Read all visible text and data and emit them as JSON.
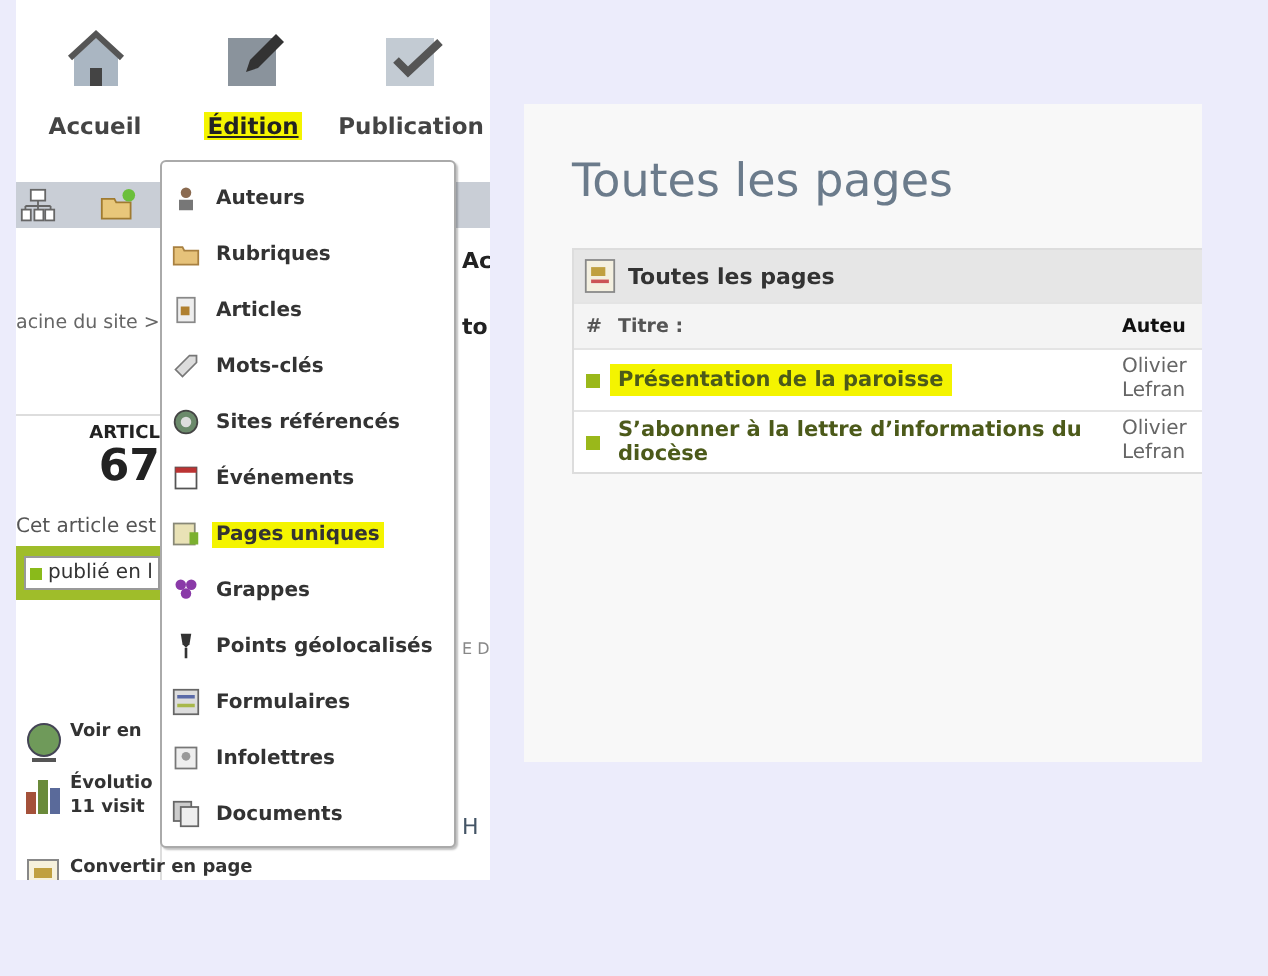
{
  "nav": [
    {
      "label": "Accueil",
      "selected": false,
      "highlighted": false
    },
    {
      "label": "Édition",
      "selected": true,
      "highlighted": true
    },
    {
      "label": "Publication",
      "selected": false,
      "highlighted": false
    }
  ],
  "background_page": {
    "heading_fragment": "Ac",
    "breadcrumb": "acine du site >",
    "title_fragment": "to",
    "stat_label": "ARTICL",
    "stat_value": "67",
    "status_text": "Cet article est",
    "status_field": "publié en l",
    "column_fragment": "E D",
    "tab_fragment": "H",
    "links": [
      {
        "lines": [
          "Voir en"
        ]
      },
      {
        "lines": [
          "Évolutio",
          "11 visit"
        ]
      },
      {
        "lines": [
          "Convertir en page"
        ]
      }
    ]
  },
  "menu": [
    {
      "label": "Auteurs",
      "highlighted": false
    },
    {
      "label": "Rubriques",
      "highlighted": false
    },
    {
      "label": "Articles",
      "highlighted": false
    },
    {
      "label": "Mots-clés",
      "highlighted": false
    },
    {
      "label": "Sites référencés",
      "highlighted": false
    },
    {
      "label": "Événements",
      "highlighted": false
    },
    {
      "label": "Pages uniques",
      "highlighted": true
    },
    {
      "label": "Grappes",
      "highlighted": false
    },
    {
      "label": "Points géolocalisés",
      "highlighted": false
    },
    {
      "label": "Formulaires",
      "highlighted": false
    },
    {
      "label": "Infolettres",
      "highlighted": false
    },
    {
      "label": "Documents",
      "highlighted": false
    }
  ],
  "pages_panel": {
    "title": "Toutes les pages",
    "box_title": "Toutes les pages",
    "columns": [
      "#",
      "Titre :",
      "Auteu"
    ],
    "rows": [
      {
        "title": "Présentation de la paroisse",
        "author": [
          "Olivier",
          "Lefran"
        ],
        "highlighted": true
      },
      {
        "title": "S’abonner à la lettre d’informations du diocèse",
        "author": [
          "Olivier",
          "Lefran"
        ],
        "highlighted": false
      }
    ]
  }
}
